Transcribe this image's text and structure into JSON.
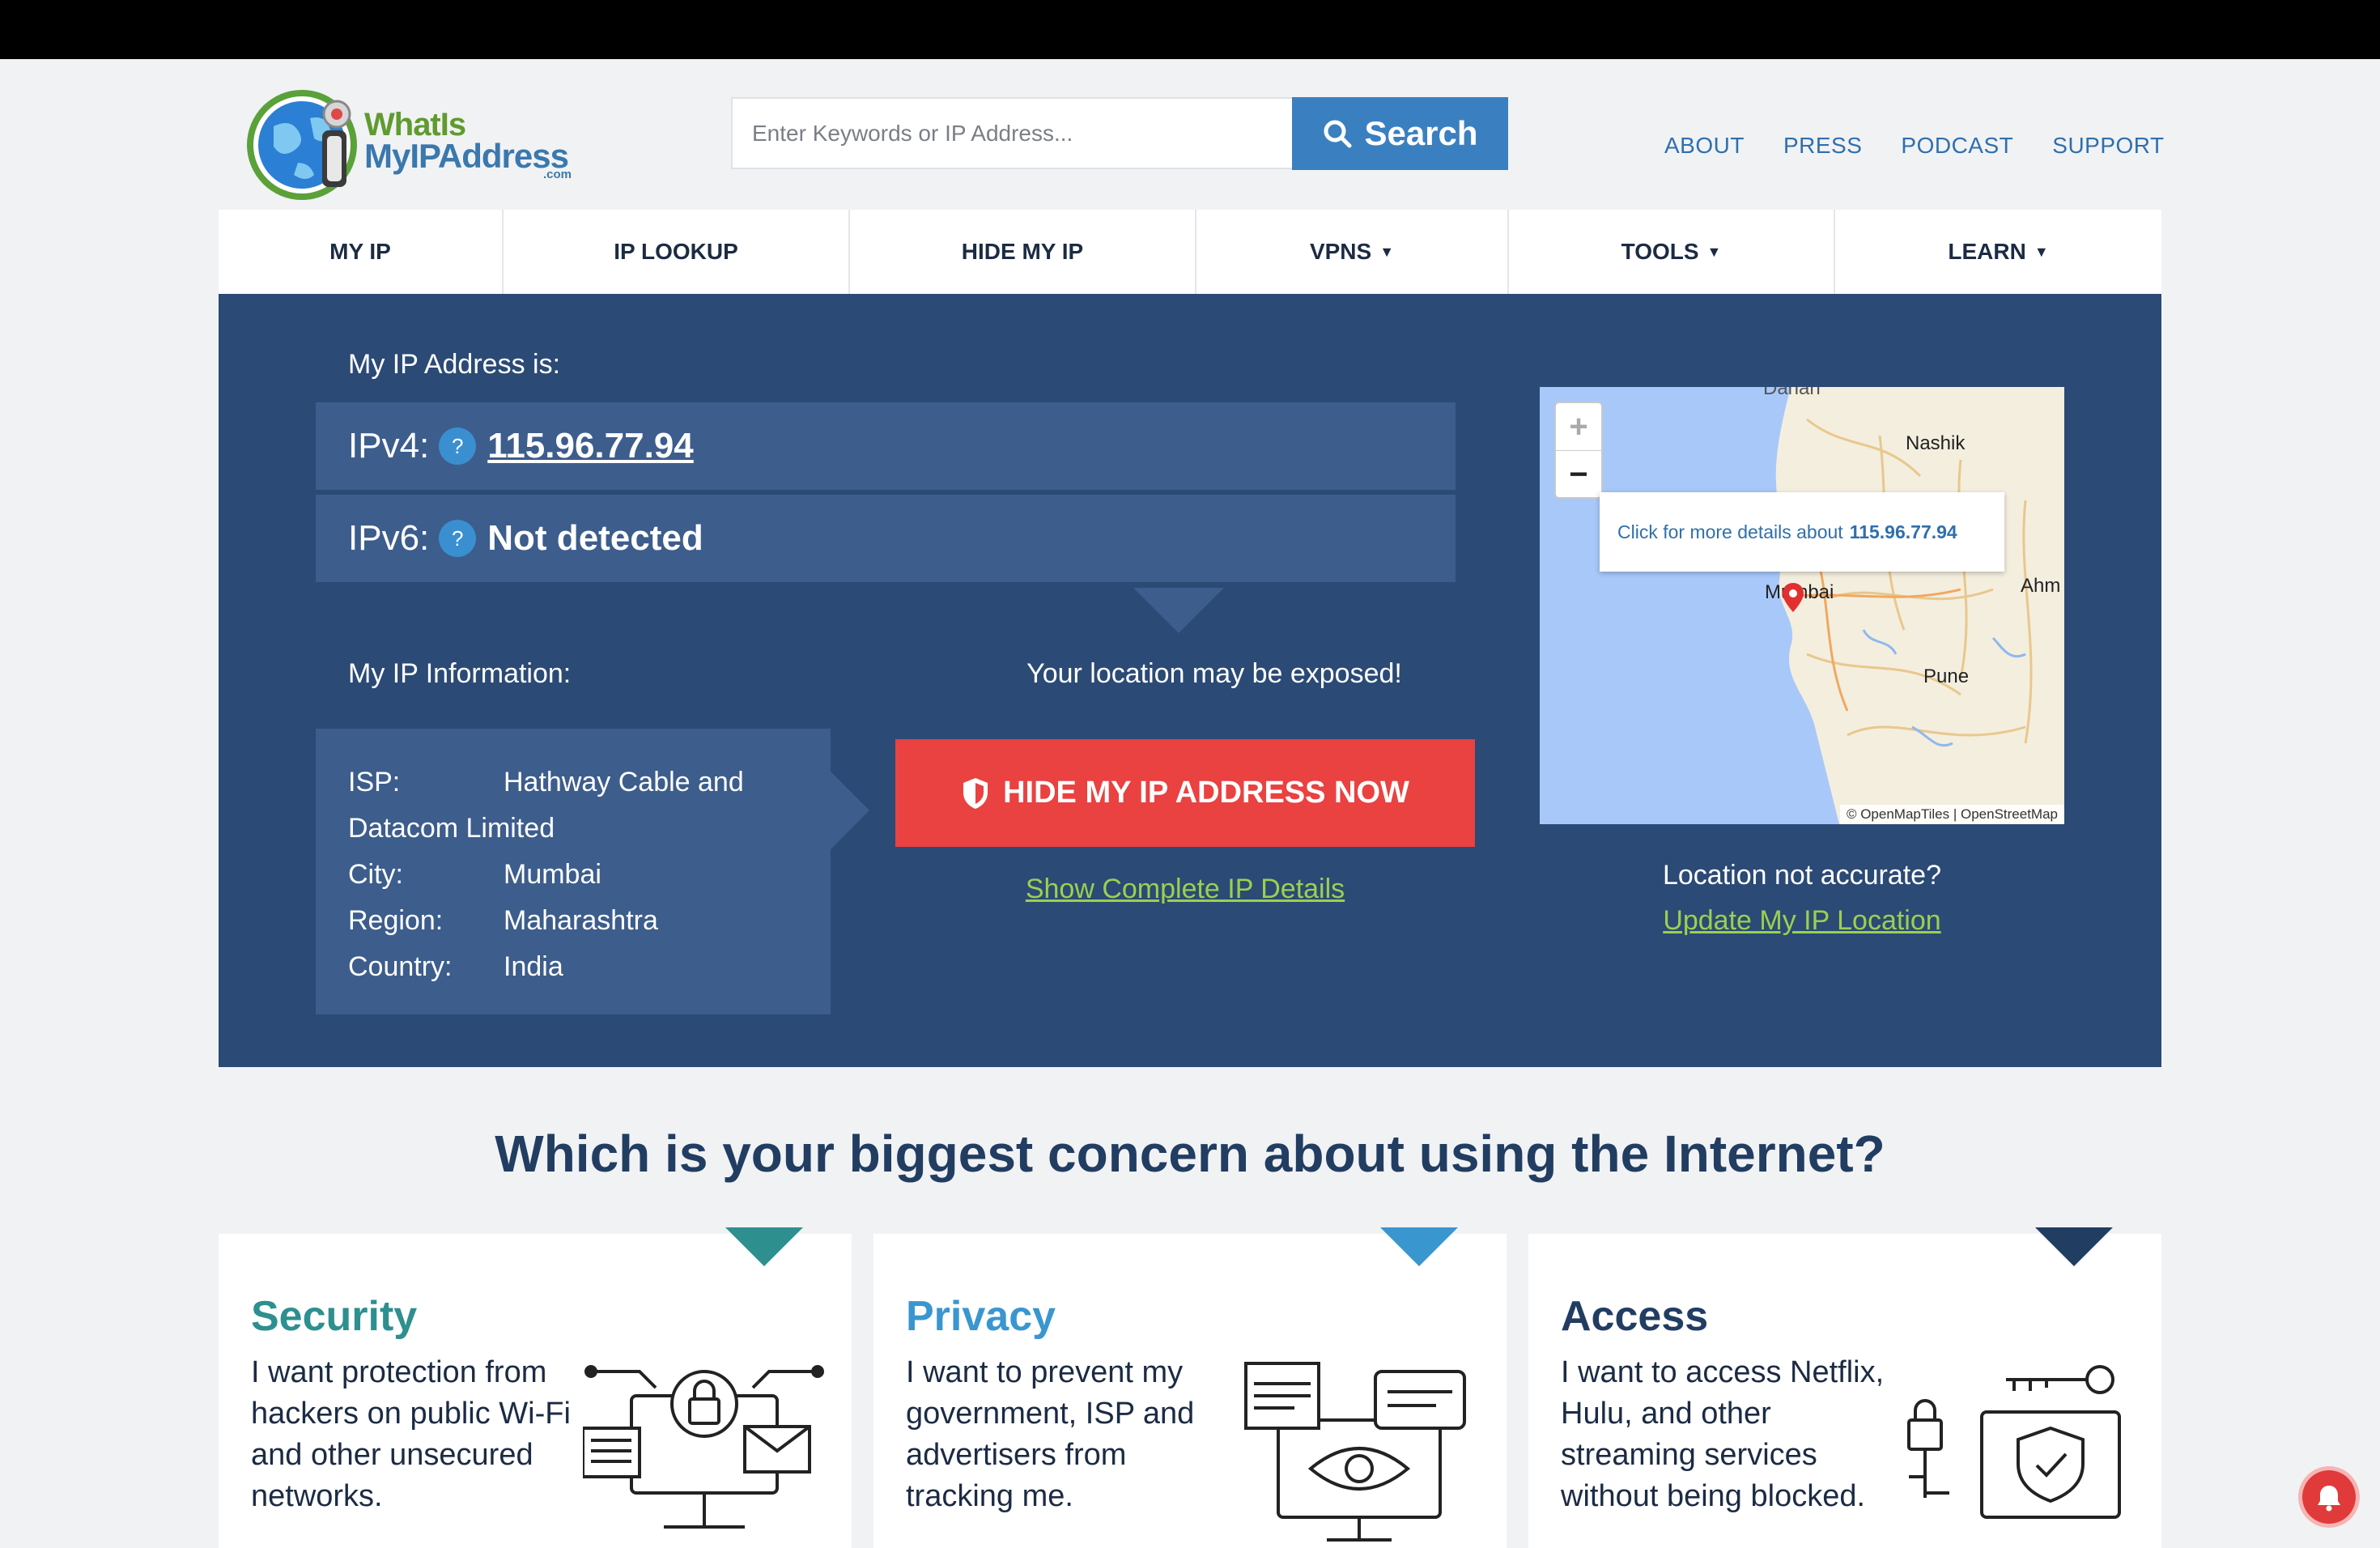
{
  "logo": {
    "line1": "WhatIs",
    "line2": "MyIPAddress",
    "line3": ".com"
  },
  "search": {
    "placeholder": "Enter Keywords or IP Address...",
    "button_label": "Search"
  },
  "top_nav": [
    "ABOUT",
    "PRESS",
    "PODCAST",
    "SUPPORT"
  ],
  "main_nav": [
    {
      "label": "MY IP",
      "dropdown": false
    },
    {
      "label": "IP LOOKUP",
      "dropdown": false
    },
    {
      "label": "HIDE MY IP",
      "dropdown": false
    },
    {
      "label": "VPNS",
      "dropdown": true
    },
    {
      "label": "TOOLS",
      "dropdown": true
    },
    {
      "label": "LEARN",
      "dropdown": true
    }
  ],
  "hero": {
    "ip_title": "My IP Address is:",
    "ipv4_label": "IPv4:",
    "ipv4_value": "115.96.77.94",
    "ipv6_label": "IPv6:",
    "ipv6_value": "Not detected",
    "help_glyph": "?",
    "info_title": "My IP Information:",
    "info": {
      "isp_label": "ISP:",
      "isp_value": "Hathway Cable and Datacom Limited",
      "city_label": "City:",
      "city_value": "Mumbai",
      "region_label": "Region:",
      "region_value": "Maharashtra",
      "country_label": "Country:",
      "country_value": "India"
    },
    "warning": "Your location may be exposed!",
    "hide_button": "HIDE MY IP ADDRESS NOW",
    "details_link": "Show Complete IP Details",
    "location_question": "Location not accurate?",
    "update_link": "Update My IP Location"
  },
  "map": {
    "zoom_in": "+",
    "zoom_out": "−",
    "popup_text": "Click for more details about",
    "popup_ip": "115.96.77.94",
    "labels": {
      "nashik": "Nashik",
      "mumbai": "Mumbai",
      "pune": "Pune",
      "ahm": "Ahm",
      "top": "Dahan"
    },
    "attribution": "© OpenMapTiles | OpenStreetMap"
  },
  "concern": {
    "heading": "Which is your biggest concern about using the Internet?",
    "cards": [
      {
        "title": "Security",
        "text": "I want protection from hackers on public Wi-Fi and other unsecured networks.",
        "color": "#2e8f8f",
        "icon": "lock-network-icon"
      },
      {
        "title": "Privacy",
        "text": "I want to prevent my government, ISP and advertisers from tracking me.",
        "color": "#3a96cf",
        "icon": "eye-monitor-icon"
      },
      {
        "title": "Access",
        "text": "I want to access Netflix, Hulu, and other streaming services without being blocked.",
        "color": "#223d62",
        "icon": "key-shield-icon"
      }
    ]
  },
  "colors": {
    "panel": "#2b4a75",
    "panel_box": "#3d5d8c",
    "cta_red": "#ea4141",
    "link_green": "#9bd04f",
    "brand_blue": "#3a80c0"
  }
}
